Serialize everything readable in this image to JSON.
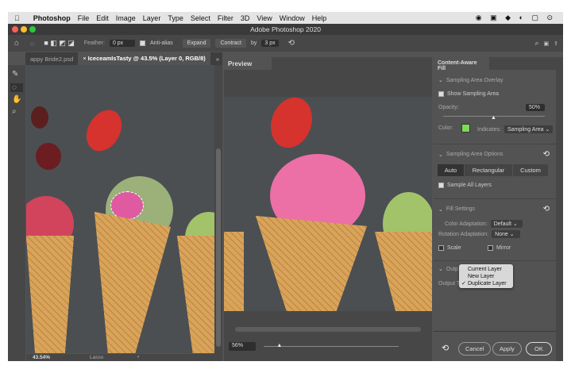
{
  "menubar": {
    "app": "Photoshop",
    "items": [
      "File",
      "Edit",
      "Image",
      "Layer",
      "Type",
      "Select",
      "Filter",
      "3D",
      "View",
      "Window",
      "Help"
    ]
  },
  "window": {
    "title": "Adobe Photoshop 2020"
  },
  "options": {
    "feather_label": "Feather:",
    "feather_value": "0 px",
    "antialias": "Anti-alias",
    "expand": "Expand",
    "contract": "Contract",
    "by": "by",
    "by_value": "3 px"
  },
  "tabs": [
    {
      "label": "appy Bride2.psd"
    },
    {
      "label": "IceceamIsTasty @ 43.5% (Layer 0, RGB/8)",
      "active": true
    }
  ],
  "status": {
    "zoom": "43.54%",
    "tool": "Lasso"
  },
  "preview": {
    "title": "Preview",
    "zoom": "56%",
    "zoom_slider": 0.12
  },
  "caf": {
    "title": "Content-Aware Fill",
    "overlay": {
      "title": "Sampling Area Overlay",
      "show": "Show Sampling Area",
      "opacity_label": "Opacity:",
      "opacity": "50%",
      "color_label": "Color:",
      "color": "#7ed957",
      "indicates_label": "Indicates:",
      "indicates": "Sampling Area"
    },
    "options": {
      "title": "Sampling Area Options",
      "modes": [
        "Auto",
        "Rectangular",
        "Custom"
      ],
      "sample_all": "Sample All Layers"
    },
    "fill": {
      "title": "Fill Settings",
      "color_label": "Color Adaptation:",
      "color_value": "Default",
      "rotation_label": "Rotation Adaptation:",
      "rotation_value": "None",
      "scale": "Scale",
      "mirror": "Mirror"
    },
    "output": {
      "title": "Outp",
      "label": "Output T",
      "menu": [
        "Current Layer",
        "New Layer",
        "Duplicate Layer"
      ],
      "checked": "Duplicate Layer"
    },
    "buttons": {
      "cancel": "Cancel",
      "apply": "Apply",
      "ok": "OK"
    }
  }
}
